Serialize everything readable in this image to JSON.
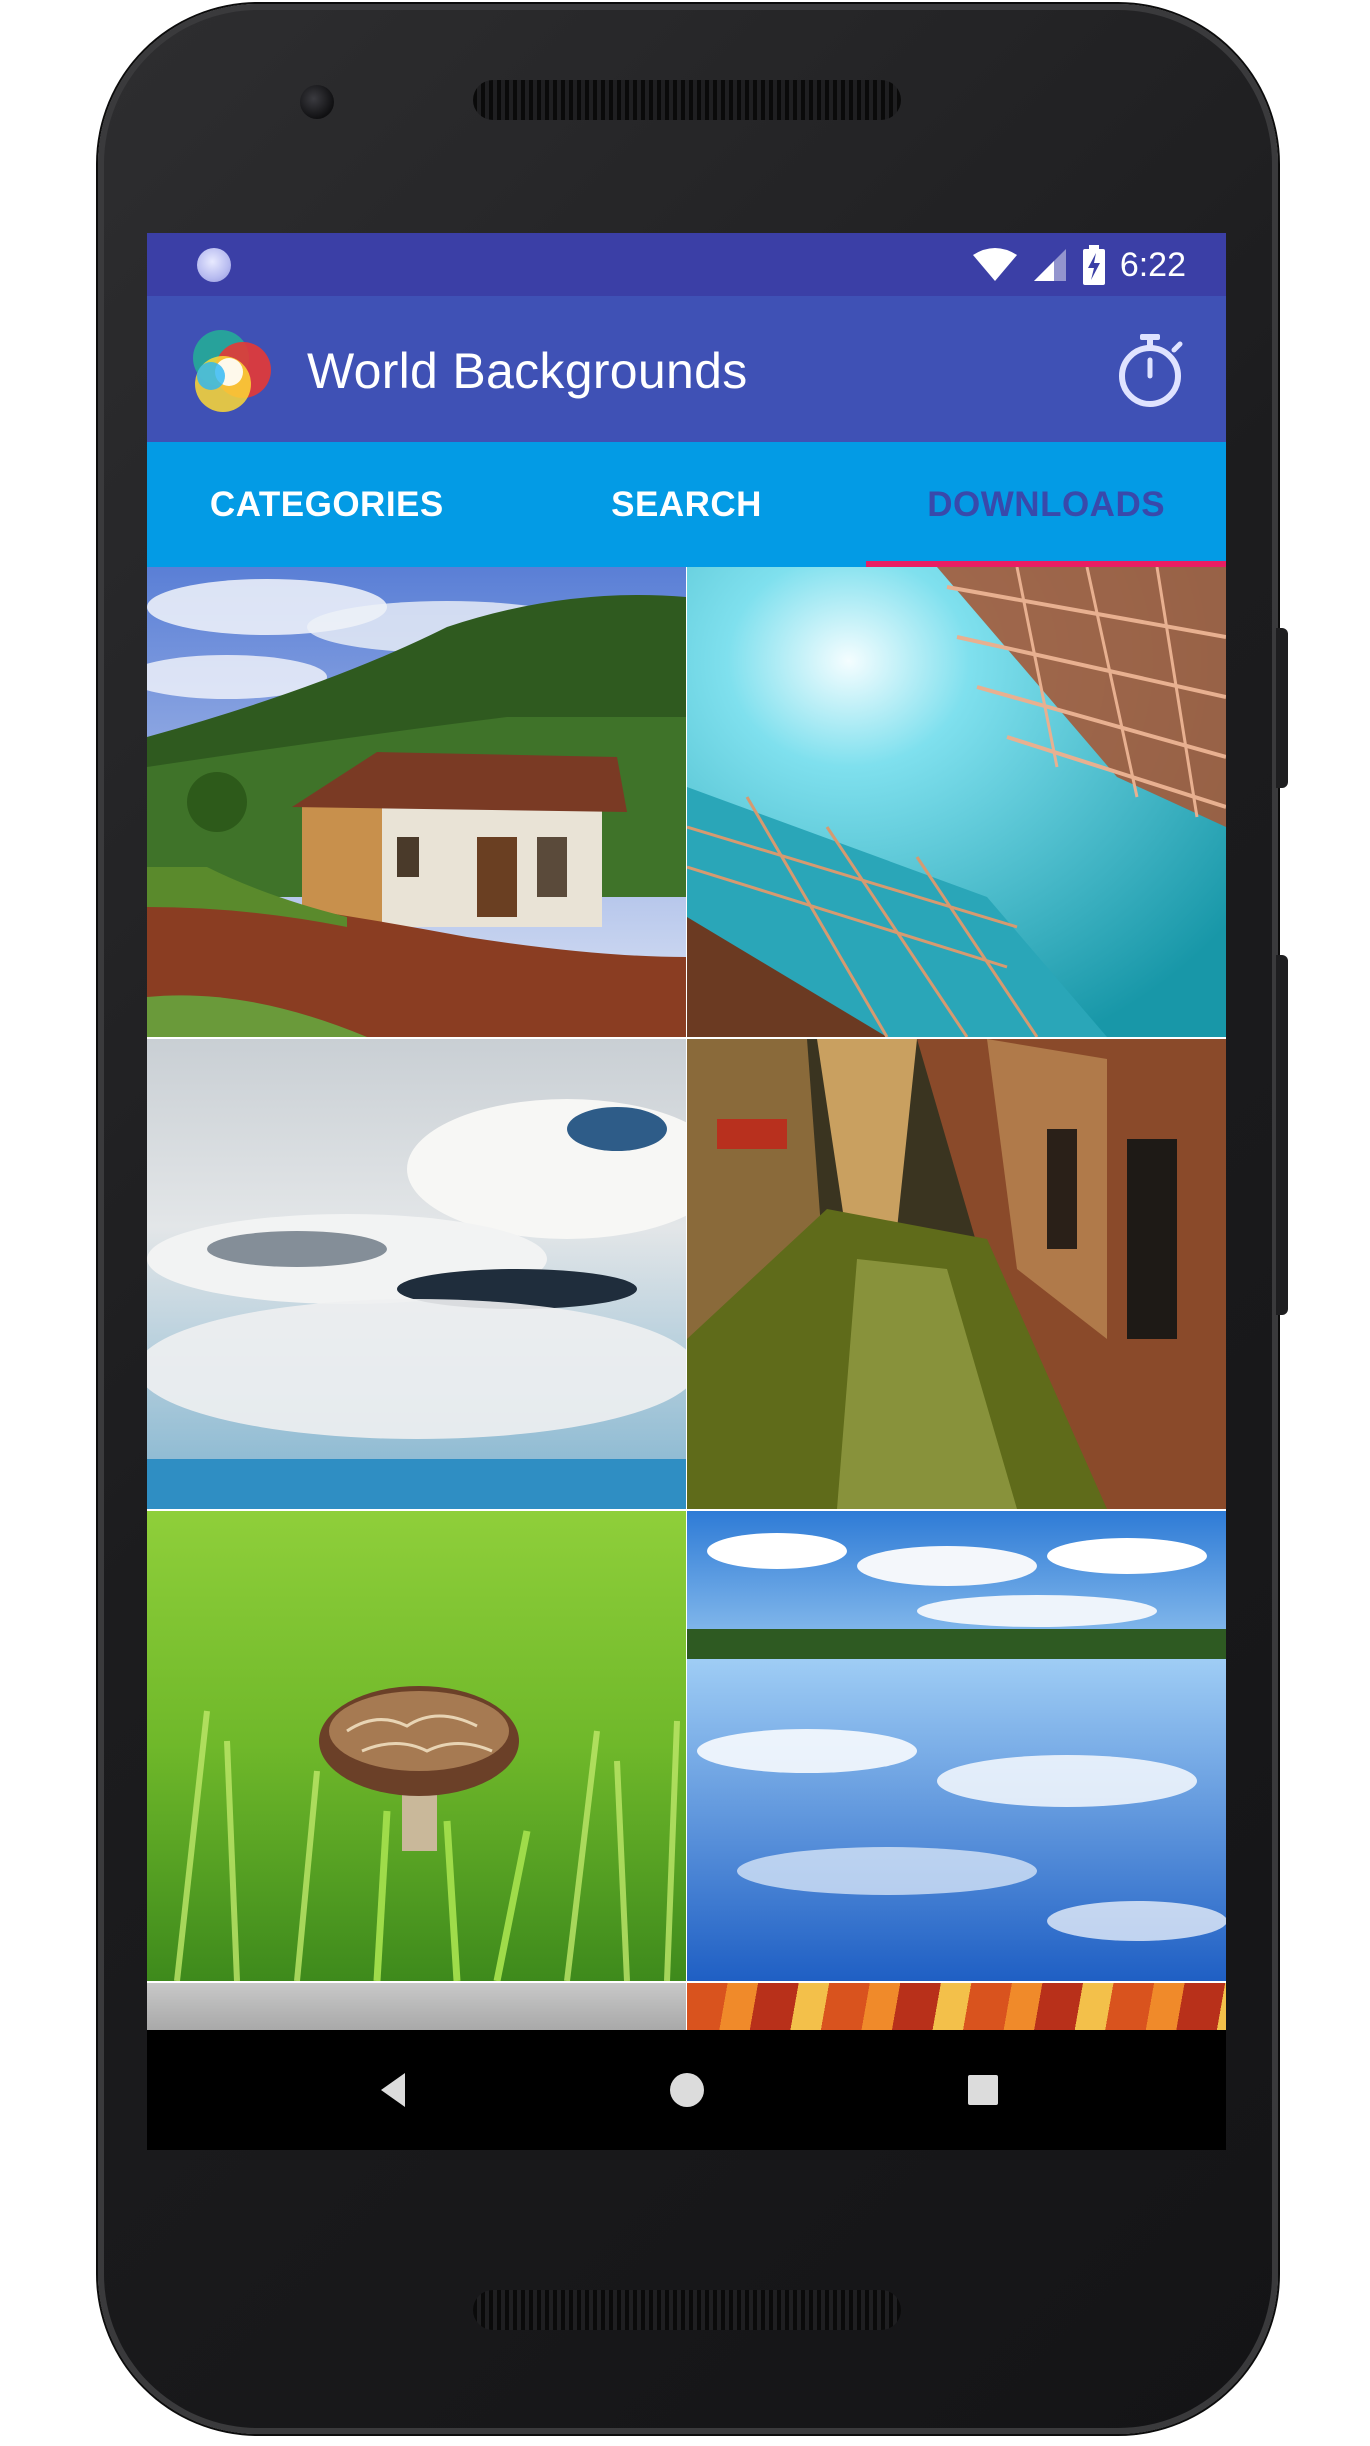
{
  "status_bar": {
    "time": "6:22",
    "icons": [
      "notification-dot-icon",
      "wifi-icon",
      "cellular-signal-icon",
      "battery-charging-icon"
    ]
  },
  "app_bar": {
    "title": "World Backgrounds",
    "logo_icon": "app-logo-icon",
    "action_icon": "timer-icon",
    "color": "#3f51b5"
  },
  "tabs": [
    {
      "label": "CATEGORIES",
      "active": false
    },
    {
      "label": "SEARCH",
      "active": false
    },
    {
      "label": "DOWNLOADS",
      "active": true
    }
  ],
  "tab_bar_color": "#039be5",
  "tab_indicator_color": "#e91e63",
  "wallpapers": [
    {
      "name": "countryside-house"
    },
    {
      "name": "glass-building"
    },
    {
      "name": "sky-clouds"
    },
    {
      "name": "venice-canal"
    },
    {
      "name": "mushroom-grass"
    },
    {
      "name": "lake-reflection"
    },
    {
      "name": "partial-gray"
    },
    {
      "name": "partial-autumn-leaves"
    }
  ],
  "nav_bar": {
    "icons": [
      "back-icon",
      "home-icon",
      "recents-icon"
    ]
  }
}
